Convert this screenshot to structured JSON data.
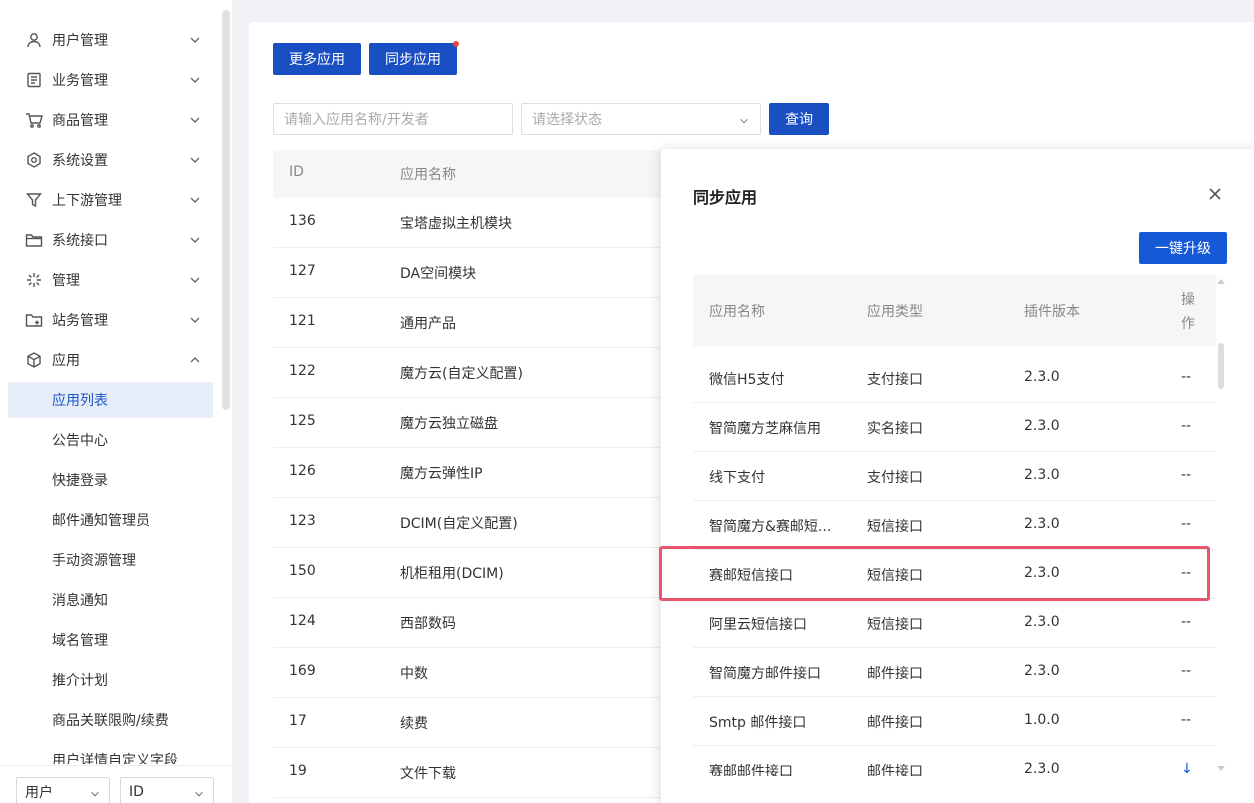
{
  "sidebar": {
    "menu": [
      {
        "label": "用户管理",
        "icon": "user-icon"
      },
      {
        "label": "业务管理",
        "icon": "document-icon"
      },
      {
        "label": "商品管理",
        "icon": "cart-icon"
      },
      {
        "label": "系统设置",
        "icon": "hexagon-gear-icon"
      },
      {
        "label": "上下游管理",
        "icon": "filter-icon"
      },
      {
        "label": "系统接口",
        "icon": "folder-icon"
      },
      {
        "label": "管理",
        "icon": "sparkle-icon"
      },
      {
        "label": "站务管理",
        "icon": "folder-plus-icon"
      },
      {
        "label": "应用",
        "icon": "cube-icon"
      }
    ],
    "submenu": [
      "应用列表",
      "公告中心",
      "快捷登录",
      "邮件通知管理员",
      "手动资源管理",
      "消息通知",
      "域名管理",
      "推介计划",
      "商品关联限购/续费",
      "用户详情自定义字段"
    ],
    "bottom_selects": [
      "用户",
      "ID"
    ]
  },
  "toolbar": {
    "more_apps": "更多应用",
    "sync_apps": "同步应用",
    "search_placeholder": "请输入应用名称/开发者",
    "status_placeholder": "请选择状态",
    "query": "查询"
  },
  "app_table": {
    "headers": [
      "ID",
      "应用名称"
    ],
    "rows": [
      {
        "id": "136",
        "name": "宝塔虚拟主机模块"
      },
      {
        "id": "127",
        "name": "DA空间模块"
      },
      {
        "id": "121",
        "name": "通用产品"
      },
      {
        "id": "122",
        "name": "魔方云(自定义配置)"
      },
      {
        "id": "125",
        "name": "魔方云独立磁盘"
      },
      {
        "id": "126",
        "name": "魔方云弹性IP"
      },
      {
        "id": "123",
        "name": "DCIM(自定义配置)"
      },
      {
        "id": "150",
        "name": "机柜租用(DCIM)"
      },
      {
        "id": "124",
        "name": "西部数码"
      },
      {
        "id": "169",
        "name": "中数"
      },
      {
        "id": "17",
        "name": "续费"
      },
      {
        "id": "19",
        "name": "文件下载"
      }
    ]
  },
  "sync_modal": {
    "title": "同步应用",
    "upgrade_all": "一键升级",
    "headers": [
      "应用名称",
      "应用类型",
      "插件版本",
      "操",
      "作"
    ],
    "rows": [
      {
        "name": "微信H5支付",
        "type": "支付接口",
        "version": "2.3.0",
        "op": "--"
      },
      {
        "name": "智简魔方芝麻信用",
        "type": "实名接口",
        "version": "2.3.0",
        "op": "--"
      },
      {
        "name": "线下支付",
        "type": "支付接口",
        "version": "2.3.0",
        "op": "--"
      },
      {
        "name": "智简魔方&赛邮短...",
        "type": "短信接口",
        "version": "2.3.0",
        "op": "--"
      },
      {
        "name": "赛邮短信接口",
        "type": "短信接口",
        "version": "2.3.0",
        "op": "--"
      },
      {
        "name": "阿里云短信接口",
        "type": "短信接口",
        "version": "2.3.0",
        "op": "--"
      },
      {
        "name": "智简魔方邮件接口",
        "type": "邮件接口",
        "version": "2.3.0",
        "op": "--"
      },
      {
        "name": "Smtp 邮件接口",
        "type": "邮件接口",
        "version": "1.0.0",
        "op": "--"
      },
      {
        "name": "赛邮邮件接口",
        "type": "邮件接口",
        "version": "2.3.0",
        "op": "↓"
      }
    ],
    "highlight_color": "#e8546b"
  },
  "colors": {
    "primary": "#1a4fc4",
    "active_bg": "#e6edf8"
  }
}
